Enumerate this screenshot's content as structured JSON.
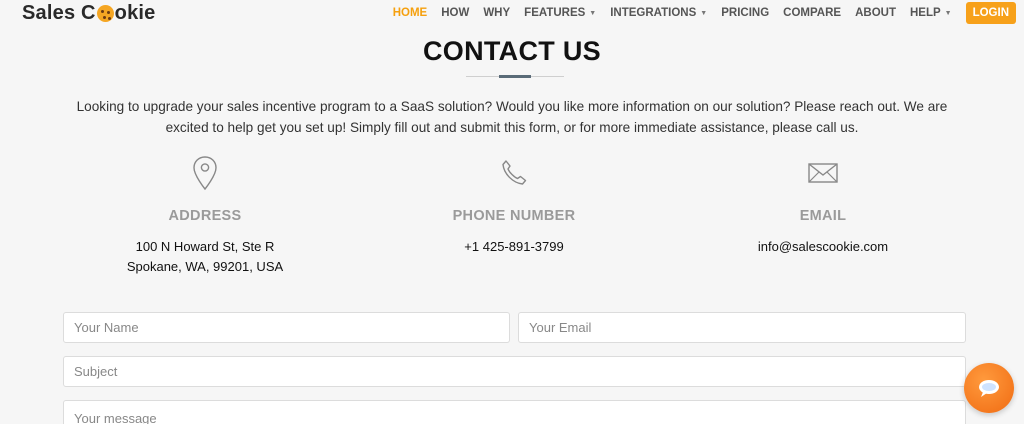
{
  "header": {
    "logo_text_1": "Sales C",
    "logo_text_2": "okie",
    "nav": [
      {
        "label": "HOME",
        "active": true
      },
      {
        "label": "HOW"
      },
      {
        "label": "WHY"
      },
      {
        "label": "FEATURES",
        "dropdown": true
      },
      {
        "label": "INTEGRATIONS",
        "dropdown": true
      },
      {
        "label": "PRICING"
      },
      {
        "label": "COMPARE"
      },
      {
        "label": "ABOUT"
      },
      {
        "label": "HELP",
        "dropdown": true
      }
    ],
    "login": "LOGIN"
  },
  "page": {
    "title": "CONTACT US",
    "intro": "Looking to upgrade your sales incentive program to a SaaS solution? Would you like more information on our solution? Please reach out. We are excited to help get you set up! Simply fill out and submit this form, or for more immediate assistance, please call us."
  },
  "contact": {
    "address": {
      "heading": "ADDRESS",
      "line1": "100 N Howard St, Ste R",
      "line2": "Spokane, WA, 99201, USA",
      "icon": "map-pin-icon"
    },
    "phone": {
      "heading": "PHONE NUMBER",
      "value": "+1 425-891-3799",
      "icon": "phone-icon"
    },
    "email": {
      "heading": "EMAIL",
      "value": "info@salescookie.com",
      "icon": "envelope-icon"
    }
  },
  "form": {
    "name_placeholder": "Your Name",
    "email_placeholder": "Your Email",
    "subject_placeholder": "Subject",
    "message_placeholder": "Your message"
  },
  "colors": {
    "accent": "#f5a00e",
    "login_bg": "#f7a11a",
    "chat_bg": "#f06b12"
  }
}
